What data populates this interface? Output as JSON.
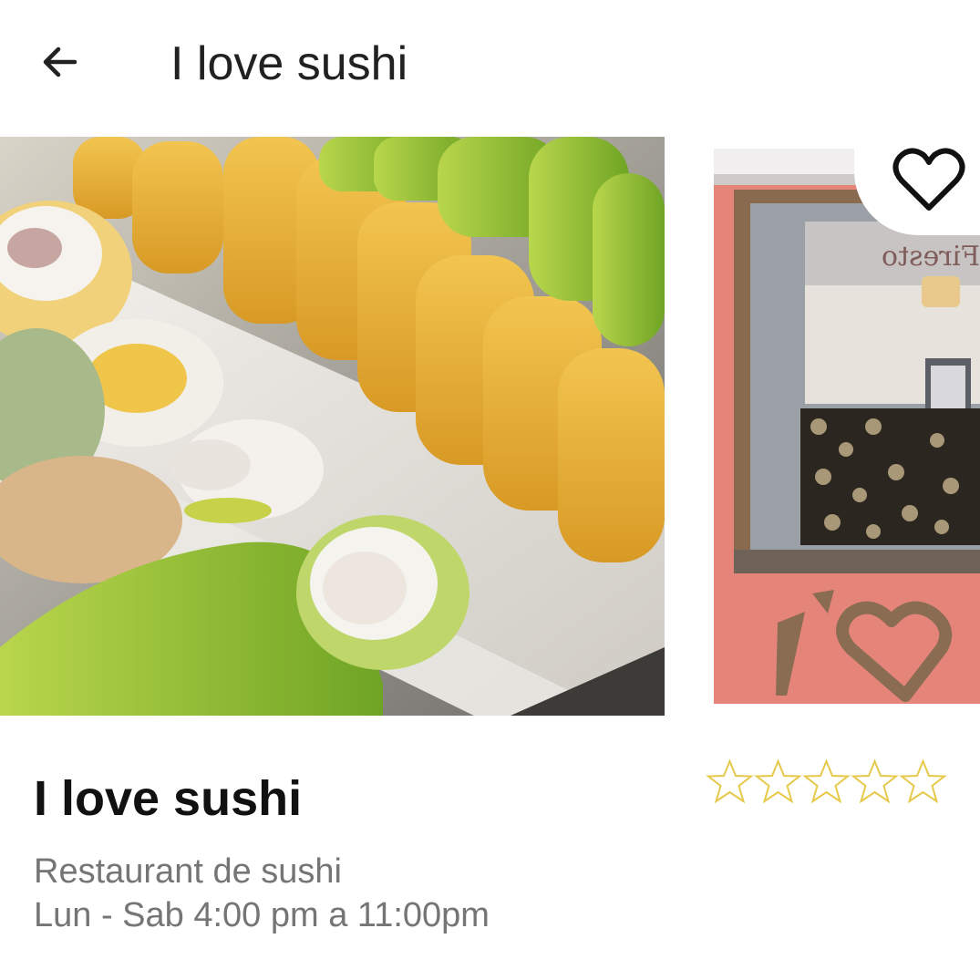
{
  "app_bar": {
    "title": "I love sushi",
    "back_icon": "arrow-left-icon"
  },
  "gallery": {
    "images": [
      {
        "name": "sushi-rolls-photo"
      },
      {
        "name": "restaurant-storefront-photo",
        "sign_text": "Firesto"
      }
    ],
    "favorite_icon": "heart-outline-icon"
  },
  "restaurant": {
    "name": "I love sushi",
    "category": "Restaurant de sushi",
    "hours": "Lun - Sab 4:00 pm a 11:00pm"
  },
  "rating": {
    "value": 0,
    "max": 5,
    "star_color": "#e6c94a"
  },
  "colors": {
    "title_text": "#212121",
    "secondary_text": "#757575",
    "wall_color": "#e5857a"
  }
}
